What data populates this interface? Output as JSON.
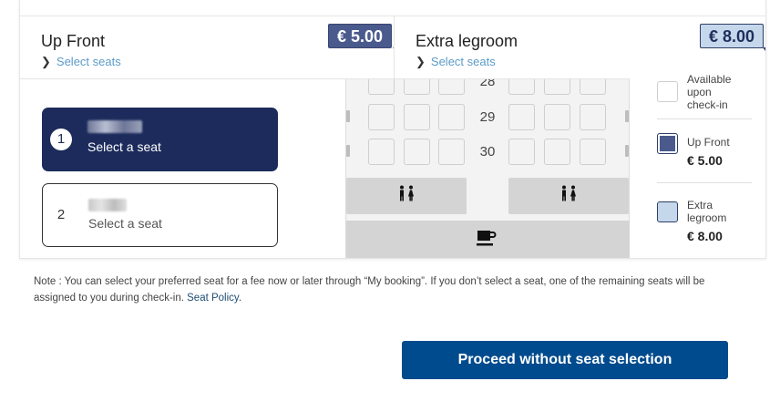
{
  "zones": [
    {
      "title": "Up Front",
      "link": "Select seats",
      "price": "€ 5.00"
    },
    {
      "title": "Extra legroom",
      "link": "Select seats",
      "price": "€ 8.00"
    }
  ],
  "rows": [
    "28",
    "29",
    "30"
  ],
  "passengers": [
    {
      "number": "1",
      "name": "Y. ZENG",
      "status": "Select a seat"
    },
    {
      "number": "2",
      "name": "",
      "status": "Select a seat"
    }
  ],
  "legend": {
    "available": "Available upon check-in",
    "upfront": {
      "label": "Up Front",
      "price": "€ 5.00"
    },
    "legroom": {
      "label": "Extra legroom",
      "price": "€ 8.00"
    }
  },
  "note": {
    "text": "Note : You can select your preferred seat for a fee now or later through “My booking”. If you don’t select a seat, one of the remaining seats will be assigned to you during check-in.",
    "link": "Seat Policy",
    "end": "."
  },
  "cta": "Proceed without seat selection",
  "icons": [
    "lavatory-icon",
    "lavatory-icon",
    "coffee-icon",
    "chevron-right-icon"
  ],
  "colors": {
    "primary": "#004b8d",
    "active_pax": "#1c2b5c",
    "upfront": "#4a5a8c",
    "legroom": "#c5d7ea",
    "link": "#5b9bc9"
  }
}
